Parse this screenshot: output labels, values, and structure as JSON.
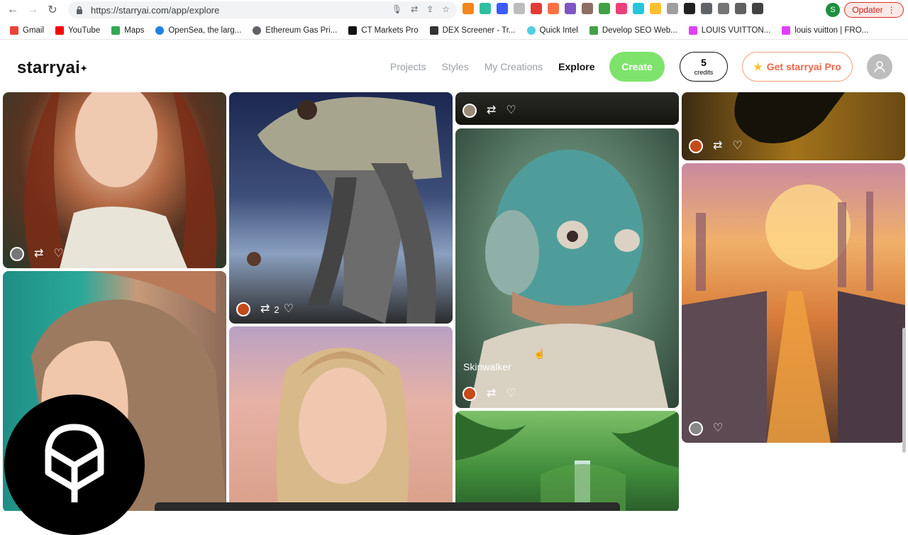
{
  "browser": {
    "url": "https://starryai.com/app/explore",
    "update_label": "Opdater",
    "profile_initial": "S",
    "bookmarks": [
      {
        "label": "Gmail",
        "icon": "gmail-icon"
      },
      {
        "label": "YouTube",
        "icon": "youtube-icon"
      },
      {
        "label": "Maps",
        "icon": "maps-icon"
      },
      {
        "label": "OpenSea, the larg...",
        "icon": "opensea-icon"
      },
      {
        "label": "Ethereum Gas Pri...",
        "icon": "ethereum-icon"
      },
      {
        "label": "CT Markets Pro",
        "icon": "ct-markets-icon"
      },
      {
        "label": "DEX Screener - Tr...",
        "icon": "dex-screener-icon"
      },
      {
        "label": "Quick Intel",
        "icon": "quick-intel-icon"
      },
      {
        "label": "Develop SEO Web...",
        "icon": "seo-icon"
      },
      {
        "label": "LOUIS VUITTON...",
        "icon": "louis-vuitton-icon"
      },
      {
        "label": "louis vuitton | FRO...",
        "icon": "louis-vuitton-icon"
      }
    ]
  },
  "header": {
    "logo": "starryai",
    "nav": [
      "Projects",
      "Styles",
      "My Creations",
      "Explore"
    ],
    "active_nav": "Explore",
    "create_label": "Create",
    "credits_count": "5",
    "credits_label": "credits",
    "pro_label": "Get starryai Pro"
  },
  "gallery": {
    "cards": [
      {
        "id": "portrait-redhead",
        "title": "",
        "remix_count": ""
      },
      {
        "id": "alien-creature",
        "title": "",
        "remix_count": "2"
      },
      {
        "id": "dark-top",
        "title": "",
        "remix_count": ""
      },
      {
        "id": "skinwalker",
        "title": "Skinwalker",
        "remix_count": ""
      },
      {
        "id": "dark-creature",
        "title": "",
        "remix_count": ""
      },
      {
        "id": "city-sunset",
        "title": "",
        "remix_count": ""
      },
      {
        "id": "profile-woman",
        "title": "",
        "remix_count": ""
      },
      {
        "id": "blonde-portrait",
        "title": "",
        "remix_count": ""
      },
      {
        "id": "jungle-waterfall",
        "title": "",
        "remix_count": ""
      }
    ]
  },
  "colors": {
    "create": "#7ee36c",
    "pro": "#f2664a",
    "update": "#c5221f"
  }
}
